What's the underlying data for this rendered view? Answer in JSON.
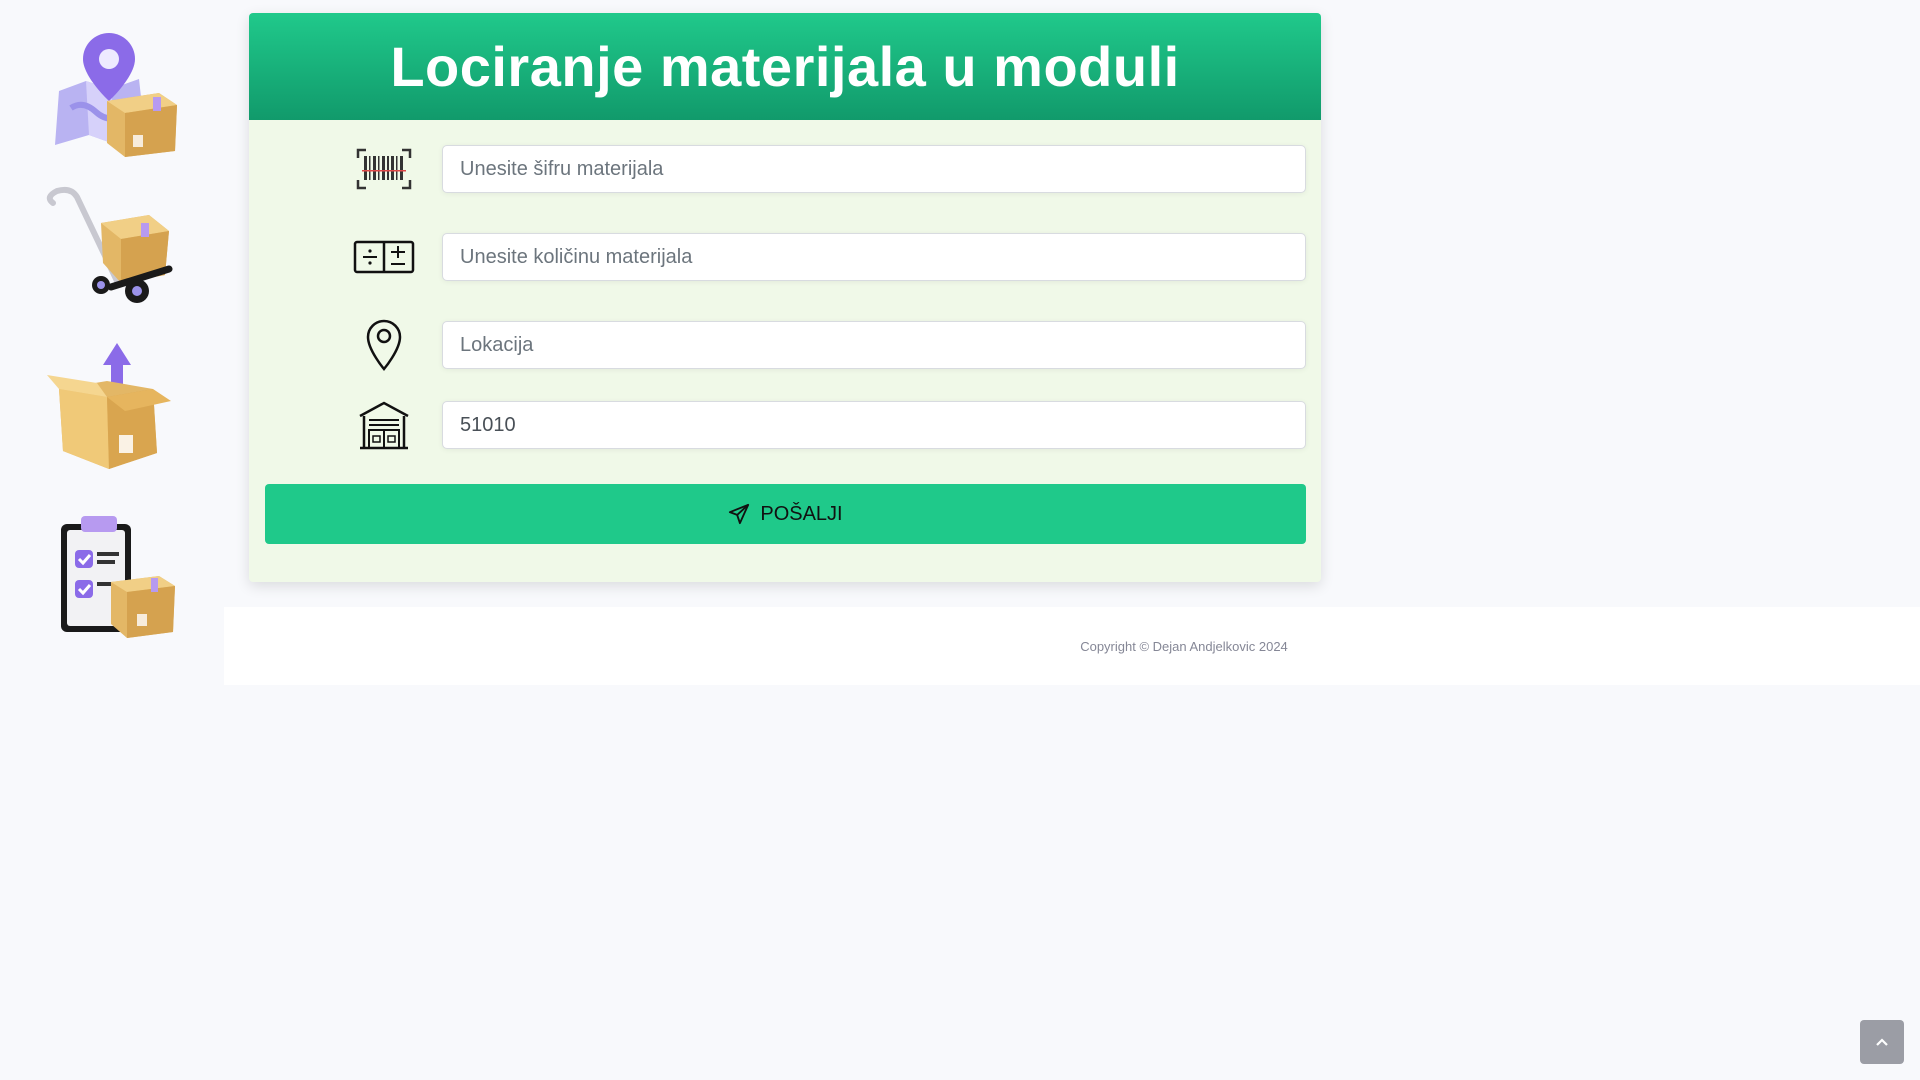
{
  "form": {
    "title": "Lociranje materijala u moduli",
    "material_code": {
      "placeholder": "Unesite šifru materijala",
      "value": ""
    },
    "quantity": {
      "placeholder": "Unesite količinu materijala",
      "value": ""
    },
    "location": {
      "placeholder": "Lokacija",
      "value": ""
    },
    "warehouse": {
      "placeholder": "",
      "value": "51010"
    },
    "submit_label": "POŠALJI"
  },
  "sidebar": {
    "items": [
      {
        "icon": "map-location-box-icon"
      },
      {
        "icon": "hand-truck-box-icon"
      },
      {
        "icon": "open-box-upload-icon"
      },
      {
        "icon": "clipboard-checklist-box-icon"
      }
    ]
  },
  "footer": {
    "copyright": "Copyright © Dejan Andjelkovic 2024"
  },
  "colors": {
    "accent": "#1fc98a",
    "header_top": "#20c98b",
    "header_bottom": "#119a6b",
    "panel": "#f0f9e8",
    "icon_purple": "#8b6be8",
    "box_tan": "#e0b863"
  }
}
